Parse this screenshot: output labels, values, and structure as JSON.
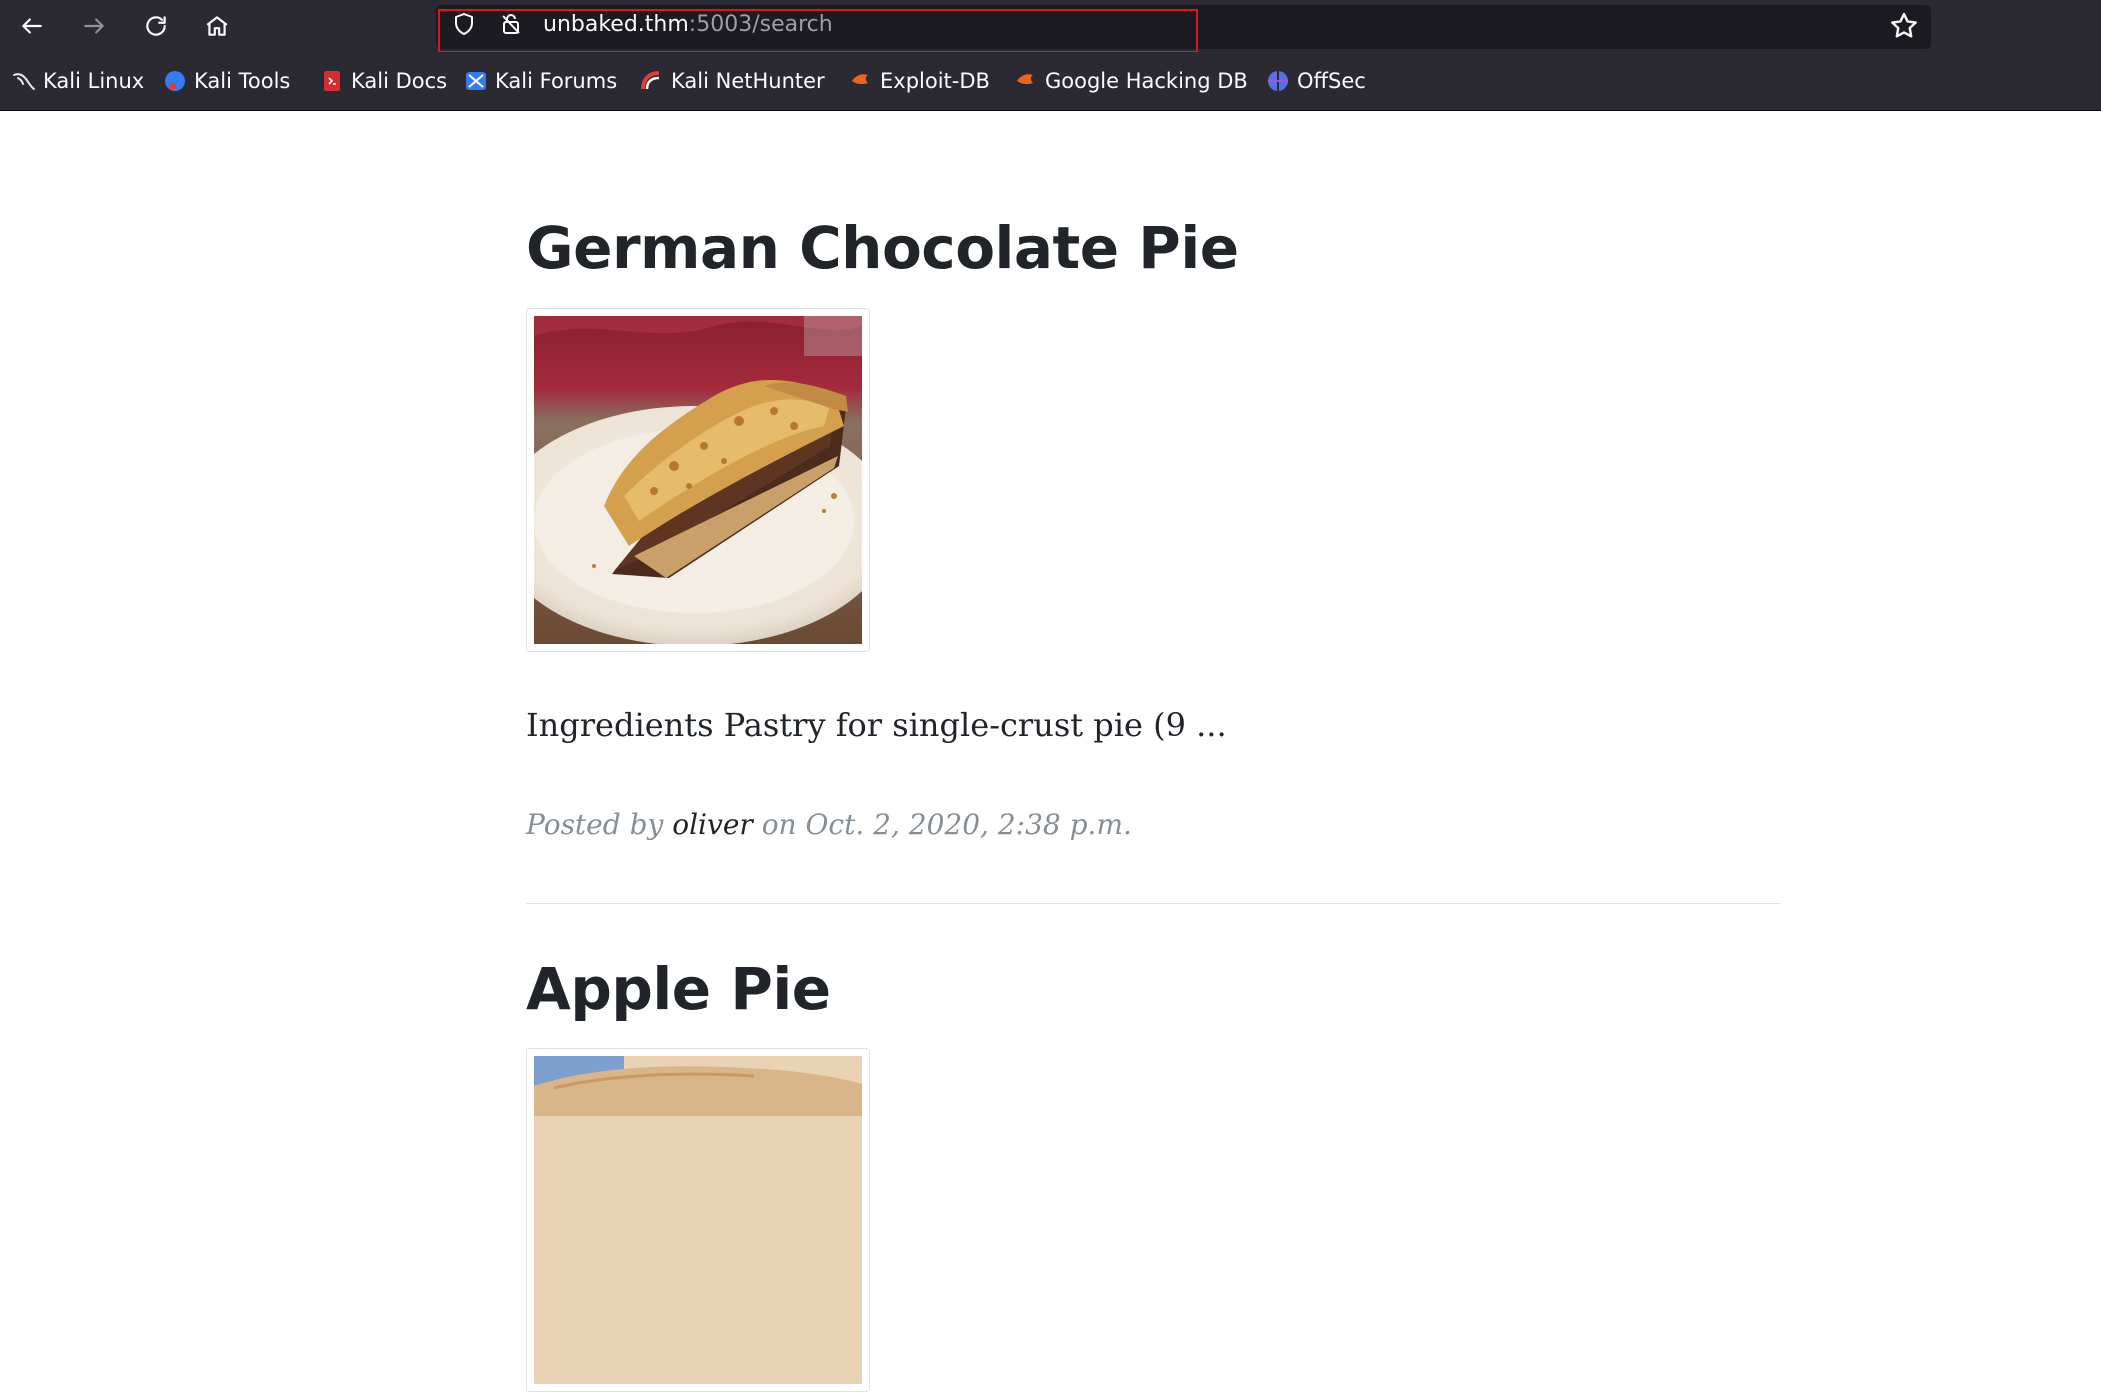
{
  "browser": {
    "url_host": "unbaked.thm",
    "url_path": ":5003/search",
    "bookmarks": [
      {
        "label": "Kali Linux",
        "icon": "kali-dragon-icon"
      },
      {
        "label": "Kali Tools",
        "icon": "kali-tools-icon"
      },
      {
        "label": "Kali Docs",
        "icon": "kali-docs-icon"
      },
      {
        "label": "Kali Forums",
        "icon": "kali-forums-icon"
      },
      {
        "label": "Kali NetHunter",
        "icon": "kali-nethunter-icon"
      },
      {
        "label": "Exploit-DB",
        "icon": "exploit-db-icon"
      },
      {
        "label": "Google Hacking DB",
        "icon": "exploit-db-icon"
      },
      {
        "label": "OffSec",
        "icon": "offsec-icon"
      }
    ]
  },
  "posts": [
    {
      "title": "German Chocolate Pie",
      "excerpt": "Ingredients Pastry for single-crust pie (9 ...",
      "meta_prefix": "Posted by",
      "author": "oliver",
      "meta_suffix": "on Oct. 2, 2020, 2:38 p.m."
    },
    {
      "title": "Apple Pie"
    }
  ],
  "colors": {
    "chrome_bg": "#2b2a33",
    "url_highlight": "#e0141e",
    "text_dark": "#212529",
    "text_muted": "#868e96"
  }
}
